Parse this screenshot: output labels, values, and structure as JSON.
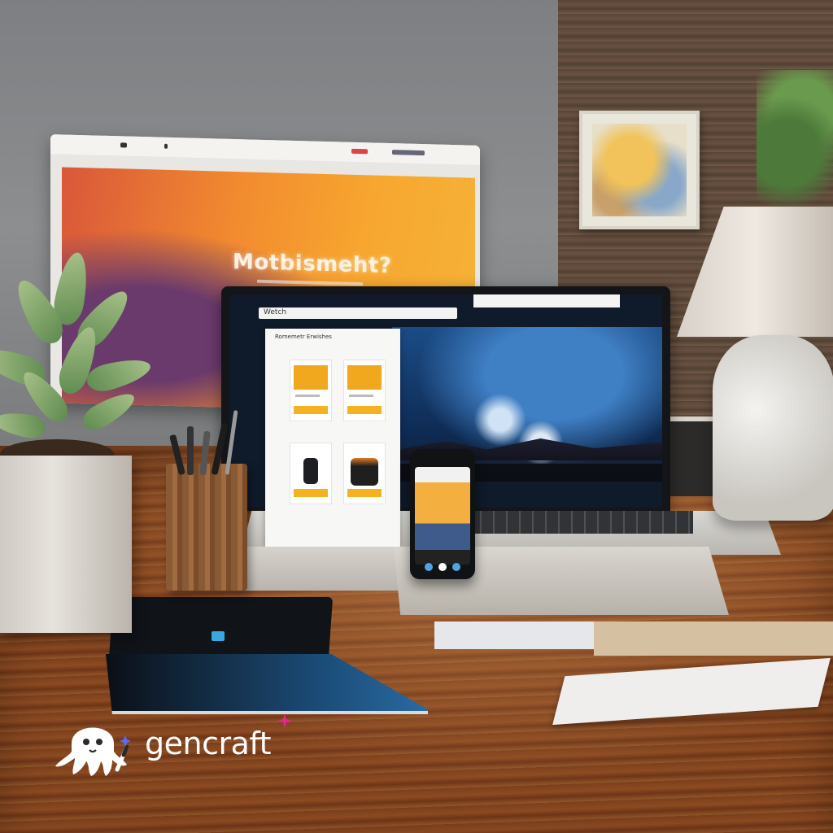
{
  "scene": {
    "monitor": {
      "headline": "Motbismeht?"
    },
    "laptop": {
      "address_bar": "Wetch",
      "panel_title": "Romemetr Erwishes"
    },
    "watermark": {
      "brand": "gencraft"
    }
  },
  "colors": {
    "accent_red": "#d4231e",
    "product_yellow": "#f1a71e",
    "desk_wood": "#8c4b22"
  },
  "icons": [
    "octopus-mascot-icon",
    "magic-wand-icon",
    "sparkle-icon"
  ]
}
